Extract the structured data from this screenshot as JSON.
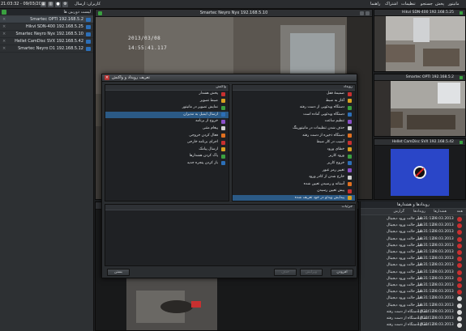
{
  "topbar": {
    "time": "21:03:32 - 09/03/2013",
    "hint": "کاربران: ارسال",
    "menus": [
      "مانیتور",
      "پخش",
      "جستجو",
      "تنظیمات",
      "اشتراک",
      "راهنما"
    ]
  },
  "left_panel": {
    "header": "لیست دوربین ها",
    "cameras": [
      {
        "label": "Smartec OPTI 192.168.5.2"
      },
      {
        "label": "Hikvi SDN-400 192.168.5.25"
      },
      {
        "label": "Smartec Neyro Nyx 192.168.5.10"
      },
      {
        "label": "Hellet CamDisc SVX 192.168.5.42"
      },
      {
        "label": "Smartec Neyro D1 192.168.5.12"
      }
    ]
  },
  "main_video": {
    "title": "Smartec Neyro Nyx 192.168.5.10",
    "osd_date": "2013/03/08",
    "osd_time": "14:55:41.117"
  },
  "thumbnails": [
    {
      "title": "Hikvi SDN-400 192.168.5.25"
    },
    {
      "title": "Smartec OPTI 192.168.5.2"
    },
    {
      "title": "Hellet CamDisc SVX 192.168.5.42"
    }
  ],
  "dialog": {
    "title": "تعریف رویداد و واکنش",
    "events_header": "رویداد",
    "events": [
      "ضمیمهٔ قفل",
      "آغاز به ضبط",
      "دستگاه ویدئویی از دست رفته",
      "دستگاه ویدئویی آماده است",
      "تنظیم ساعت",
      "حذف شدن تنظیمات در مانیتورینگ",
      "دستگاه ذخیره از دست رفته",
      "آسیب در کار ضبط",
      "خطای ورود",
      "ورود کاربر",
      "خروج کاربر",
      "تغییر رمز عبور",
      "خارج شدن از کادر ورود",
      "آستانه و رسیدن تعیین شده",
      "پیش تعیین رسیدن",
      "پیدایش ویدئو در خود تعریف شده"
    ],
    "events_selected": 15,
    "actions_header": "واکنش",
    "actions": [
      "پخش هشدار",
      "ضبط تصویر",
      "نمایش تصویر در مانیتور",
      "ارسال ایمیل به مدیران",
      "خروج از برنامه",
      "پیغام متنی",
      "فعال کردن خروجی",
      "اجرای برنامه خارجی",
      "ارسال پیامک",
      "پاک کردن هشدارها",
      "باز کردن پنجره جدید"
    ],
    "actions_selected": 3,
    "details_header": "جزئیات",
    "btn_add": "افزودن",
    "btn_edit": "ویرایش",
    "btn_delete": "حذف",
    "btn_ok": "ذخیره",
    "btn_close": "بستن"
  },
  "events_panel": {
    "header": "رویدادها و هشدارها",
    "tabs": [
      "همه",
      "هشدارها",
      "رویدادها",
      "گزارش"
    ],
    "rows": [
      {
        "date": "08.03.2013",
        "time": "14:31:12",
        "msg": "تغییر حالت ورود دیجیتال",
        "status": "error"
      },
      {
        "date": "08.03.2013",
        "time": "14:31:12",
        "msg": "تغییر حالت ورود دیجیتال",
        "status": "error"
      },
      {
        "date": "08.03.2013",
        "time": "14:31:12",
        "msg": "تغییر حالت ورود دیجیتال",
        "status": "error"
      },
      {
        "date": "08.03.2013",
        "time": "14:31:12",
        "msg": "تغییر حالت ورود دیجیتال",
        "status": "error"
      },
      {
        "date": "08.03.2013",
        "time": "14:31:12",
        "msg": "تغییر حالت ورود دیجیتال",
        "status": "error"
      },
      {
        "date": "08.03.2013",
        "time": "14:31:12",
        "msg": "تغییر حالت ورود دیجیتال",
        "status": "error"
      },
      {
        "date": "08.03.2013",
        "time": "14:31:12",
        "msg": "تغییر حالت ورود دیجیتال",
        "status": "error"
      },
      {
        "date": "08.03.2013",
        "time": "14:31:12",
        "msg": "تغییر حالت ورود دیجیتال",
        "status": "error"
      },
      {
        "date": "08.03.2013",
        "time": "14:31:12",
        "msg": "تغییر حالت ورود دیجیتال",
        "status": "error"
      },
      {
        "date": "08.03.2013",
        "time": "14:31:12",
        "msg": "تغییر حالت ورود دیجیتال",
        "status": "error"
      },
      {
        "date": "08.03.2013",
        "time": "14:31:12",
        "msg": "تغییر حالت ورود دیجیتال",
        "status": "error"
      },
      {
        "date": "08.03.2013",
        "time": "14:31:12",
        "msg": "تغییر حالت ورود دیجیتال",
        "status": "error"
      },
      {
        "date": "08.03.2013",
        "time": "14:31:12",
        "msg": "تغییر حالت ورود دیجیتال",
        "status": "info"
      },
      {
        "date": "08.03.2013",
        "time": "14:31:12",
        "msg": "تغییر حالت ورود دیجیتال",
        "status": "info"
      },
      {
        "date": "08.03.2013",
        "time": "14:31:12",
        "msg": "اتصال دستگاه از دست رفته",
        "status": "info"
      },
      {
        "date": "08.03.2013",
        "time": "14:31:12",
        "msg": "اتصال دستگاه از دست رفته",
        "status": "info"
      },
      {
        "date": "08.03.2013",
        "time": "14:31:12",
        "msg": "اتصال دستگاه از دست رفته",
        "status": "info"
      }
    ]
  },
  "colors": {
    "background": "#1c1e20",
    "accent_selected": "#2b5a86",
    "status_error": "#c73030",
    "status_info": "#d8d8d8",
    "ok_green": "#3aa040",
    "camera_blue": "#2c6fb8"
  }
}
